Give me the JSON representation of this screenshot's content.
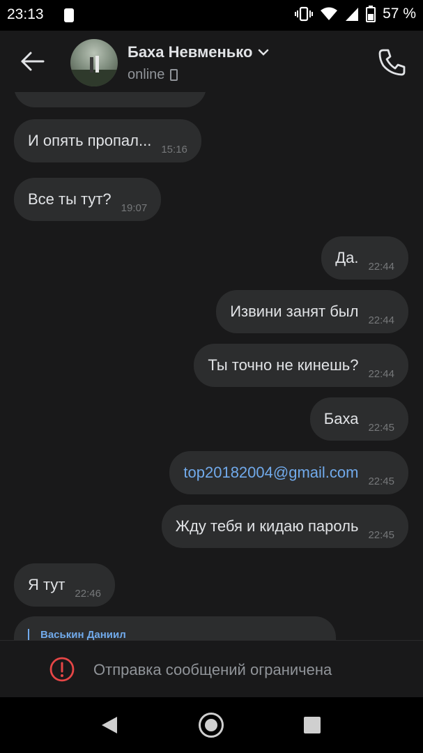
{
  "status_bar": {
    "time": "23:13",
    "battery": "57 %"
  },
  "header": {
    "contact_name": "Баха Невменько",
    "status": "online"
  },
  "messages": [
    {
      "side": "in",
      "text": "И опять пропал...",
      "time": "15:16"
    },
    {
      "side": "in",
      "text": "Все ты тут?",
      "time": "19:07"
    },
    {
      "side": "out",
      "text": "Да.",
      "time": "22:44"
    },
    {
      "side": "out",
      "text": "Извини занят был",
      "time": "22:44"
    },
    {
      "side": "out",
      "text": "Ты точно не кинешь?",
      "time": "22:44"
    },
    {
      "side": "out",
      "text": "Баха",
      "time": "22:45"
    },
    {
      "side": "out",
      "text": "top20182004@gmail.com",
      "time": "22:45",
      "is_link": true
    },
    {
      "side": "out",
      "text": "Жду тебя и кидаю пароль",
      "time": "22:45"
    },
    {
      "side": "in",
      "text": "Я тут",
      "time": "22:46"
    },
    {
      "side": "in",
      "forwarded_from": "Васькин Даниил"
    }
  ],
  "restricted_bar": {
    "text": "Отправка сообщений ограничена"
  },
  "nav_bar": {
    "icons": [
      "back-triangle-icon",
      "home-circle-icon",
      "recents-square-icon"
    ]
  },
  "colors": {
    "background": "#19191a",
    "bubble": "#2c2d2e",
    "link": "#71aaeb",
    "warning": "#e64646"
  }
}
